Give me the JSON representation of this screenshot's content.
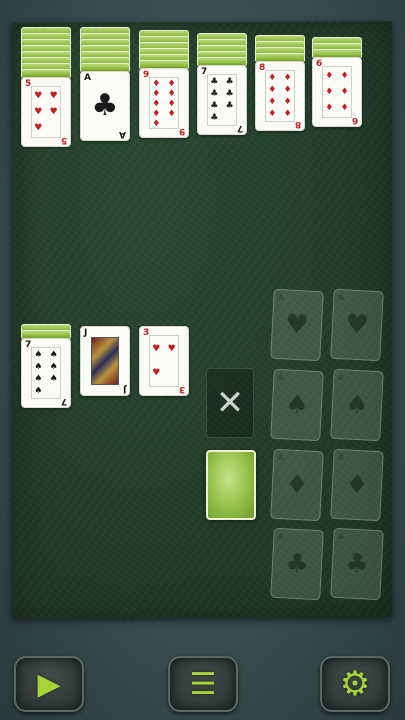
{
  "game": "Solitaire",
  "tableau_top": [
    {
      "backs": 8,
      "card": {
        "rank": "5",
        "suit": "♥",
        "color": "red"
      }
    },
    {
      "backs": 7,
      "card": {
        "rank": "A",
        "suit": "♣",
        "color": "black"
      }
    },
    {
      "backs": 6,
      "card": {
        "rank": "9",
        "suit": "♦",
        "color": "red"
      }
    },
    {
      "backs": 5,
      "card": {
        "rank": "7",
        "suit": "♣",
        "color": "black"
      }
    },
    {
      "backs": 4,
      "card": {
        "rank": "8",
        "suit": "♦",
        "color": "red"
      }
    },
    {
      "backs": 3,
      "card": {
        "rank": "6",
        "suit": "♦",
        "color": "red"
      }
    }
  ],
  "tableau_bottom": [
    {
      "backs": 2,
      "card": {
        "rank": "7",
        "suit": "♠",
        "color": "black"
      }
    },
    {
      "backs": 0,
      "card": {
        "rank": "J",
        "suit": "♣",
        "color": "black"
      }
    },
    {
      "backs": 0,
      "card": {
        "rank": "3",
        "suit": "♥",
        "color": "red"
      }
    }
  ],
  "foundations": [
    {
      "rank": "A",
      "suit": "♥"
    },
    {
      "rank": "A",
      "suit": "♥"
    },
    {
      "rank": "A",
      "suit": "♠"
    },
    {
      "rank": "A",
      "suit": "♠"
    },
    {
      "rank": "A",
      "suit": "♦"
    },
    {
      "rank": "A",
      "suit": "♦"
    },
    {
      "rank": "A",
      "suit": "♣"
    },
    {
      "rank": "A",
      "suit": "♣"
    }
  ],
  "stock": {
    "empty_symbol": "✕"
  },
  "buttons": {
    "play_icon": "play-icon",
    "menu_icon": "menu-icon",
    "settings_icon": "gear-icon",
    "play_glyph": "▶",
    "menu_glyph": "☰",
    "settings_glyph": "⚙"
  },
  "colors": {
    "accent": "#a4d63a",
    "felt": "#243f2b",
    "red_suit": "#c41e1e"
  }
}
